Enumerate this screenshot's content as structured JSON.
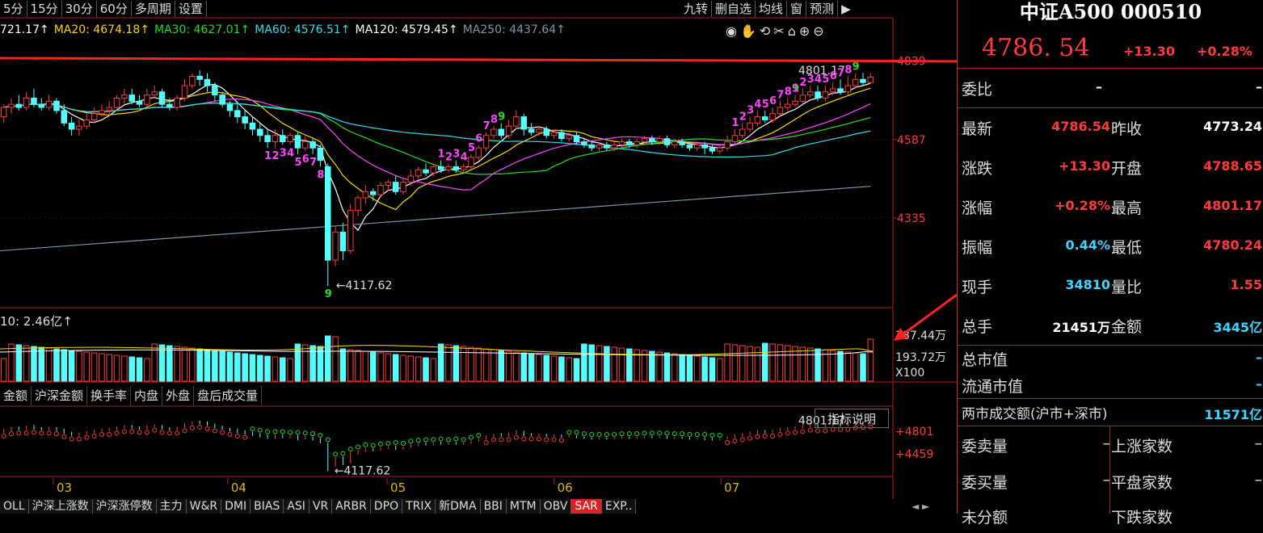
{
  "period_bar": [
    "5分",
    "15分",
    "30分",
    "60分",
    "多周期",
    "设置"
  ],
  "func_bar": [
    "九转",
    "删自选",
    "均线",
    "窗",
    "预测"
  ],
  "ma_legend": [
    {
      "text": "721.17↑",
      "color": "#ffffff"
    },
    {
      "text": "MA20: 4674.18↑",
      "color": "#ffd400"
    },
    {
      "text": "MA30: 4627.01↑",
      "color": "#22dd22"
    },
    {
      "text": "MA60: 4576.51↑",
      "color": "#33ddee"
    },
    {
      "text": "MA120: 4579.45↑",
      "color": "#ffffff"
    },
    {
      "text": "MA250: 4437.64↑",
      "color": "#7a9aa8"
    }
  ],
  "tool_icons": [
    "eye-icon",
    "hand-icon",
    "undo-icon",
    "scissors-icon",
    "lock-icon",
    "zoom-in-icon",
    "zoom-out-icon"
  ],
  "tool_glyphs": "◉✋⟲✂⌂⊕⊖",
  "chart_data": {
    "type": "candlestick",
    "price_axis_ticks": [
      4839,
      4587,
      4335
    ],
    "ylim": [
      4050,
      4900
    ],
    "high_label": "4801.17",
    "low_label": "4117.62",
    "x_month_labels": [
      "03",
      "04",
      "05",
      "06",
      "07"
    ],
    "candles": [
      [
        4660,
        4690,
        4640,
        4700
      ],
      [
        4690,
        4700,
        4670,
        4720
      ],
      [
        4700,
        4690,
        4680,
        4730
      ],
      [
        4690,
        4720,
        4680,
        4740
      ],
      [
        4720,
        4700,
        4690,
        4750
      ],
      [
        4700,
        4690,
        4680,
        4720
      ],
      [
        4690,
        4710,
        4680,
        4730
      ],
      [
        4710,
        4680,
        4670,
        4720
      ],
      [
        4680,
        4640,
        4630,
        4700
      ],
      [
        4640,
        4620,
        4600,
        4660
      ],
      [
        4620,
        4630,
        4600,
        4650
      ],
      [
        4630,
        4650,
        4620,
        4670
      ],
      [
        4650,
        4670,
        4640,
        4690
      ],
      [
        4670,
        4680,
        4660,
        4700
      ],
      [
        4680,
        4690,
        4660,
        4710
      ],
      [
        4690,
        4720,
        4680,
        4730
      ],
      [
        4720,
        4730,
        4700,
        4750
      ],
      [
        4730,
        4710,
        4700,
        4750
      ],
      [
        4710,
        4700,
        4690,
        4730
      ],
      [
        4700,
        4730,
        4690,
        4750
      ],
      [
        4730,
        4740,
        4720,
        4760
      ],
      [
        4740,
        4700,
        4690,
        4750
      ],
      [
        4700,
        4690,
        4680,
        4720
      ],
      [
        4690,
        4720,
        4680,
        4730
      ],
      [
        4720,
        4760,
        4710,
        4780
      ],
      [
        4760,
        4790,
        4750,
        4800
      ],
      [
        4790,
        4780,
        4760,
        4810
      ],
      [
        4780,
        4760,
        4740,
        4800
      ],
      [
        4760,
        4730,
        4710,
        4770
      ],
      [
        4730,
        4700,
        4690,
        4740
      ],
      [
        4700,
        4680,
        4660,
        4710
      ],
      [
        4680,
        4660,
        4640,
        4700
      ],
      [
        4660,
        4640,
        4620,
        4680
      ],
      [
        4640,
        4620,
        4600,
        4660
      ],
      [
        4620,
        4600,
        4580,
        4640
      ],
      [
        4600,
        4580,
        4560,
        4620
      ],
      [
        4580,
        4600,
        4560,
        4620
      ],
      [
        4600,
        4580,
        4570,
        4620
      ],
      [
        4580,
        4600,
        4570,
        4610
      ],
      [
        4600,
        4560,
        4540,
        4610
      ],
      [
        4560,
        4580,
        4550,
        4600
      ],
      [
        4580,
        4560,
        4540,
        4590
      ],
      [
        4560,
        4520,
        4500,
        4570
      ],
      [
        4500,
        4200,
        4117,
        4510
      ],
      [
        4200,
        4290,
        4180,
        4310
      ],
      [
        4290,
        4230,
        4200,
        4320
      ],
      [
        4230,
        4360,
        4220,
        4380
      ],
      [
        4360,
        4400,
        4340,
        4410
      ],
      [
        4400,
        4420,
        4380,
        4440
      ],
      [
        4420,
        4410,
        4390,
        4430
      ],
      [
        4410,
        4440,
        4400,
        4450
      ],
      [
        4440,
        4450,
        4420,
        4460
      ],
      [
        4450,
        4420,
        4410,
        4470
      ],
      [
        4420,
        4450,
        4410,
        4460
      ],
      [
        4450,
        4470,
        4440,
        4490
      ],
      [
        4470,
        4490,
        4460,
        4500
      ],
      [
        4490,
        4480,
        4470,
        4510
      ],
      [
        4480,
        4500,
        4470,
        4510
      ],
      [
        4500,
        4490,
        4480,
        4520
      ],
      [
        4490,
        4500,
        4480,
        4510
      ],
      [
        4500,
        4490,
        4480,
        4520
      ],
      [
        4490,
        4500,
        4480,
        4510
      ],
      [
        4500,
        4530,
        4490,
        4540
      ],
      [
        4530,
        4560,
        4520,
        4570
      ],
      [
        4560,
        4600,
        4550,
        4610
      ],
      [
        4600,
        4620,
        4590,
        4630
      ],
      [
        4620,
        4600,
        4590,
        4640
      ],
      [
        4600,
        4630,
        4590,
        4650
      ],
      [
        4630,
        4660,
        4620,
        4680
      ],
      [
        4660,
        4620,
        4600,
        4670
      ],
      [
        4620,
        4610,
        4600,
        4640
      ],
      [
        4610,
        4620,
        4600,
        4630
      ],
      [
        4620,
        4600,
        4590,
        4630
      ],
      [
        4600,
        4610,
        4590,
        4620
      ],
      [
        4610,
        4590,
        4580,
        4620
      ],
      [
        4590,
        4600,
        4580,
        4610
      ],
      [
        4600,
        4580,
        4570,
        4610
      ],
      [
        4580,
        4570,
        4560,
        4590
      ],
      [
        4570,
        4560,
        4550,
        4580
      ],
      [
        4560,
        4570,
        4550,
        4580
      ],
      [
        4570,
        4560,
        4550,
        4580
      ],
      [
        4560,
        4570,
        4550,
        4580
      ],
      [
        4570,
        4580,
        4560,
        4590
      ],
      [
        4580,
        4570,
        4560,
        4590
      ],
      [
        4570,
        4580,
        4560,
        4590
      ],
      [
        4580,
        4590,
        4570,
        4600
      ],
      [
        4590,
        4580,
        4570,
        4600
      ],
      [
        4580,
        4590,
        4570,
        4600
      ],
      [
        4590,
        4570,
        4560,
        4600
      ],
      [
        4570,
        4580,
        4560,
        4590
      ],
      [
        4580,
        4570,
        4560,
        4590
      ],
      [
        4570,
        4560,
        4550,
        4580
      ],
      [
        4560,
        4570,
        4550,
        4580
      ],
      [
        4570,
        4560,
        4540,
        4580
      ],
      [
        4560,
        4550,
        4540,
        4570
      ],
      [
        4550,
        4560,
        4540,
        4570
      ],
      [
        4560,
        4580,
        4550,
        4600
      ],
      [
        4580,
        4600,
        4570,
        4620
      ],
      [
        4600,
        4620,
        4590,
        4640
      ],
      [
        4620,
        4640,
        4610,
        4660
      ],
      [
        4640,
        4660,
        4630,
        4680
      ],
      [
        4660,
        4650,
        4640,
        4680
      ],
      [
        4650,
        4670,
        4640,
        4690
      ],
      [
        4670,
        4690,
        4660,
        4710
      ],
      [
        4690,
        4700,
        4680,
        4720
      ],
      [
        4700,
        4710,
        4690,
        4730
      ],
      [
        4710,
        4730,
        4700,
        4750
      ],
      [
        4730,
        4740,
        4720,
        4760
      ],
      [
        4740,
        4720,
        4710,
        4760
      ],
      [
        4720,
        4740,
        4710,
        4760
      ],
      [
        4740,
        4750,
        4730,
        4770
      ],
      [
        4750,
        4740,
        4730,
        4780
      ],
      [
        4740,
        4760,
        4730,
        4790
      ],
      [
        4760,
        4780,
        4750,
        4800
      ],
      [
        4780,
        4770,
        4760,
        4801
      ],
      [
        4770,
        4787,
        4765,
        4800
      ]
    ],
    "td_labels": [
      "1",
      "2",
      "3",
      "4",
      "5",
      "6",
      "7",
      "8",
      "9"
    ],
    "volume_axis_labels": [
      "387.44万",
      "193.72万",
      "X100"
    ],
    "sar_axis_labels": [
      "+4801",
      "+4459"
    ],
    "sar_high_label": "4801.17",
    "sar_low_label": "4117.62"
  },
  "vol_legend": "10: 2.46亿↑",
  "vol_tabs": [
    "金额",
    "沪深金额",
    "换手率",
    "内盘",
    "外盘",
    "盘后成交量"
  ],
  "ind_button": "指标说明",
  "bottom_tabs": [
    "OLL",
    "沪深上涨数",
    "沪深涨停数",
    "主力",
    "W&R",
    "DMI",
    "BIAS",
    "ASI",
    "VR",
    "ARBR",
    "DPO",
    "TRIX",
    "新DMA",
    "BBI",
    "MTM",
    "OBV",
    "SAR",
    "EXP.."
  ],
  "bottom_active": "SAR",
  "panel": {
    "title": "中证A500 000510",
    "price": "4786. 54",
    "change": "+13.30",
    "pct": "+0.28%",
    "weibi_label": "委比",
    "weibi_val": "–",
    "weibi_val2": "–",
    "rows": [
      {
        "l1": "最新",
        "v1": "4786.54",
        "c1": "red",
        "l2": "昨收",
        "v2": "4773.24",
        "c2": "white"
      },
      {
        "l1": "涨跌",
        "v1": "+13.30",
        "c1": "red",
        "l2": "开盘",
        "v2": "4788.65",
        "c2": "red"
      },
      {
        "l1": "涨幅",
        "v1": "+0.28%",
        "c1": "red",
        "l2": "最高",
        "v2": "4801.17",
        "c2": "red"
      },
      {
        "l1": "振幅",
        "v1": "0.44%",
        "c1": "cyan",
        "l2": "最低",
        "v2": "4780.24",
        "c2": "red"
      },
      {
        "l1": "现手",
        "v1": "34810",
        "c1": "cyan",
        "l2": "量比",
        "v2": "1.55",
        "c2": "red"
      },
      {
        "l1": "总手",
        "v1": "21451万",
        "c1": "white",
        "l2": "金额",
        "v2": "3445亿",
        "c2": "cyan"
      }
    ],
    "mcap_label": "总市值",
    "mcap_val": "–",
    "float_label": "流通市值",
    "float_val": "–",
    "turnover_label": "两市成交额(沪市+深市)",
    "turnover_val": "11571亿",
    "bottom_rows": [
      {
        "l1": "委卖量",
        "v1": "–",
        "l2": "上涨家数",
        "v2": "–"
      },
      {
        "l1": "委买量",
        "v1": "–",
        "l2": "平盘家数",
        "v2": "–"
      },
      {
        "l1": "未分额",
        "v1": "",
        "l2": "下跌家数",
        "v2": ""
      }
    ]
  }
}
